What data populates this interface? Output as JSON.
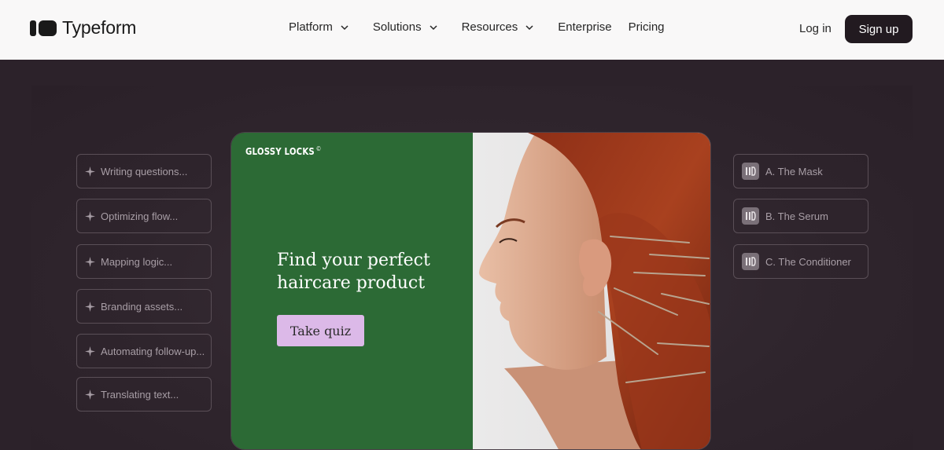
{
  "header": {
    "brand": "Typeform",
    "nav": [
      {
        "label": "Platform",
        "has_dropdown": true
      },
      {
        "label": "Solutions",
        "has_dropdown": true
      },
      {
        "label": "Resources",
        "has_dropdown": true
      },
      {
        "label": "Enterprise",
        "has_dropdown": false
      },
      {
        "label": "Pricing",
        "has_dropdown": false
      }
    ],
    "login": "Log in",
    "signup": "Sign up"
  },
  "hero": {
    "ai_steps": [
      "Writing questions...",
      "Optimizing flow...",
      "Mapping logic...",
      "Branding assets...",
      "Automating follow-up...",
      "Translating text..."
    ],
    "card": {
      "brand": "GLOSSY LOCKS",
      "brand_mark": "©",
      "headline": "Find your perfect haircare product",
      "cta": "Take quiz"
    },
    "options": [
      "A. The Mask",
      "B. The Serum",
      "C. The Conditioner"
    ]
  },
  "colors": {
    "header_bg": "#f9f8f8",
    "hero_bg": "#2c222a",
    "card_green": "#2c6a35",
    "cta_lilac": "#dcb9e8",
    "signup_bg": "#221a20"
  }
}
